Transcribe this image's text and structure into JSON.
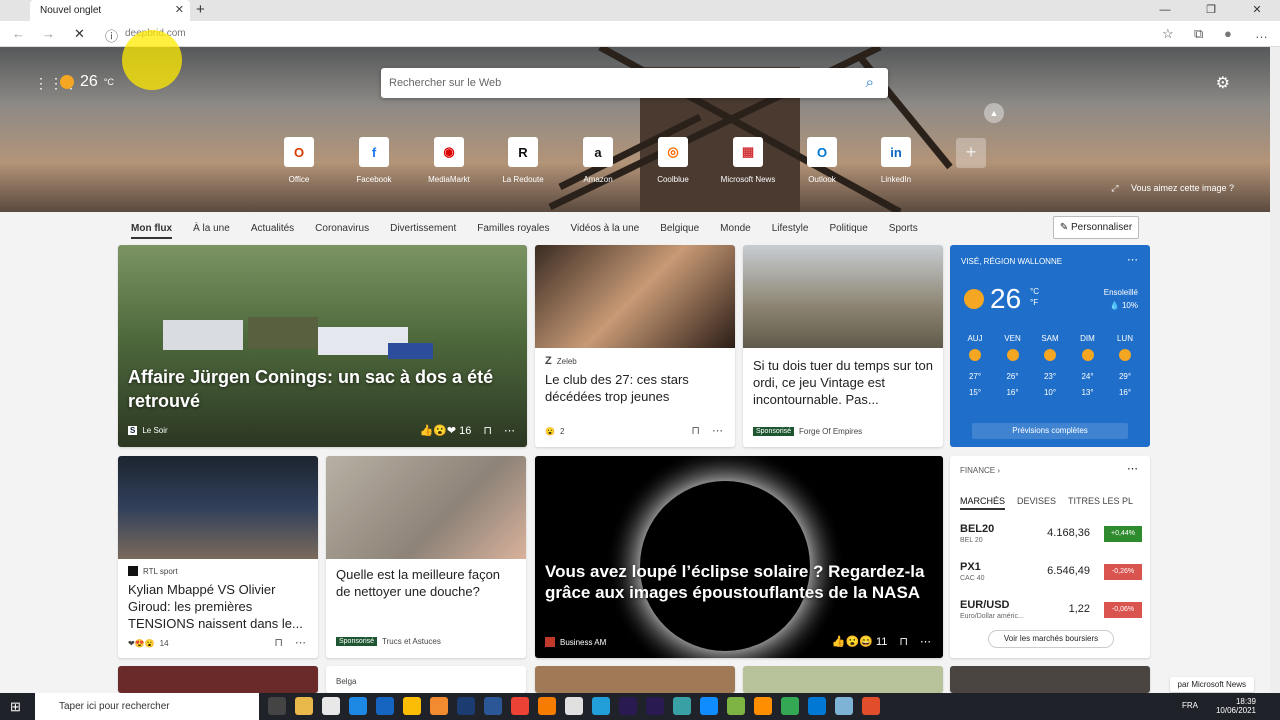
{
  "browser": {
    "tab_title": "Nouvel onglet",
    "url": "deepbrid.com"
  },
  "top": {
    "temp": "26",
    "unit": "°C",
    "search_placeholder": "Rechercher sur le Web",
    "image_question": "Vous aimez cette image ?"
  },
  "quicklinks": [
    {
      "label": "Office",
      "glyph": "O",
      "color": "#d83b01"
    },
    {
      "label": "Facebook",
      "glyph": "f",
      "color": "#1877f2"
    },
    {
      "label": "MediaMarkt",
      "glyph": "◉",
      "color": "#df0000"
    },
    {
      "label": "La Redoute",
      "glyph": "R",
      "color": "#111"
    },
    {
      "label": "Amazon",
      "glyph": "a",
      "color": "#111"
    },
    {
      "label": "Coolblue",
      "glyph": "◎",
      "color": "#ff6a00"
    },
    {
      "label": "Microsoft News",
      "glyph": "▦",
      "color": "#d13438"
    },
    {
      "label": "Outlook",
      "glyph": "O",
      "color": "#0078d4"
    },
    {
      "label": "LinkedIn",
      "glyph": "in",
      "color": "#0a66c2"
    }
  ],
  "nav": {
    "tabs": [
      "Mon flux",
      "À la une",
      "Actualités",
      "Coronavirus",
      "Divertissement",
      "Familles royales",
      "Vidéos à la une",
      "Belgique",
      "Monde",
      "Lifestyle",
      "Politique",
      "Sports"
    ],
    "personalize": "Personnaliser"
  },
  "cards": {
    "main": {
      "title": "Affaire Jürgen Conings: un sac à dos a été retrouvé",
      "source": "Le Soir",
      "reactions": "16"
    },
    "zeleb": {
      "title": "Le club des 27: ces stars décédées trop jeunes",
      "source": "Zeleb",
      "reactions": "2"
    },
    "game": {
      "title": "Si tu dois tuer du temps sur ton ordi, ce jeu Vintage est incontournable. Pas...",
      "sponsored": "Sponsorisé",
      "source": "Forge Of Empires"
    },
    "mbappe": {
      "title": "Kylian Mbappé VS Olivier Giroud: les premières TENSIONS naissent dans le...",
      "source": "RTL sport",
      "reactions": "14"
    },
    "douche": {
      "title": "Quelle est la meilleure façon de nettoyer une douche?",
      "sponsored": "Sponsorisé",
      "source": "Trucs et Astuces"
    },
    "eclipse": {
      "title": "Vous avez loupé l’éclipse solaire ? Regardez-la grâce aux images époustouflantes de la NASA",
      "source": "Business AM",
      "reactions": "11"
    },
    "belga": {
      "source": "Belga"
    }
  },
  "weather": {
    "location": "VISÉ, RÉGION WALLONNE",
    "temp": "26",
    "unit_c": "°C",
    "unit_f": "°F",
    "condition": "Ensoleillé",
    "rain": "10%",
    "days": [
      {
        "d": "AUJ",
        "hi": "27°",
        "lo": "15°"
      },
      {
        "d": "VEN",
        "hi": "26°",
        "lo": "16°"
      },
      {
        "d": "SAM",
        "hi": "23°",
        "lo": "10°"
      },
      {
        "d": "DIM",
        "hi": "24°",
        "lo": "13°"
      },
      {
        "d": "LUN",
        "hi": "29°",
        "lo": "16°"
      }
    ],
    "full": "Prévisions complètes"
  },
  "finance": {
    "header": "FINANCE",
    "tabs": [
      "MARCHÉS",
      "DEVISES",
      "TITRES LES PL"
    ],
    "rows": [
      {
        "name": "BEL20",
        "sub": "BEL 20",
        "value": "4.168,36",
        "change": "+0,44%",
        "color": "#2e8b2e"
      },
      {
        "name": "PX1",
        "sub": "CAC 40",
        "value": "6.546,49",
        "change": "-0,26%",
        "color": "#d9534f"
      },
      {
        "name": "EUR/USD",
        "sub": "Euro/Dollar améric...",
        "value": "1,22",
        "change": "-0,06%",
        "color": "#d9534f"
      }
    ],
    "more": "Voir les marchés boursiers"
  },
  "ms_badge": "par Microsoft News",
  "taskbar": {
    "search": "Taper ici pour rechercher",
    "lang": "FRA",
    "time": "18:39",
    "date": "10/06/2021"
  }
}
